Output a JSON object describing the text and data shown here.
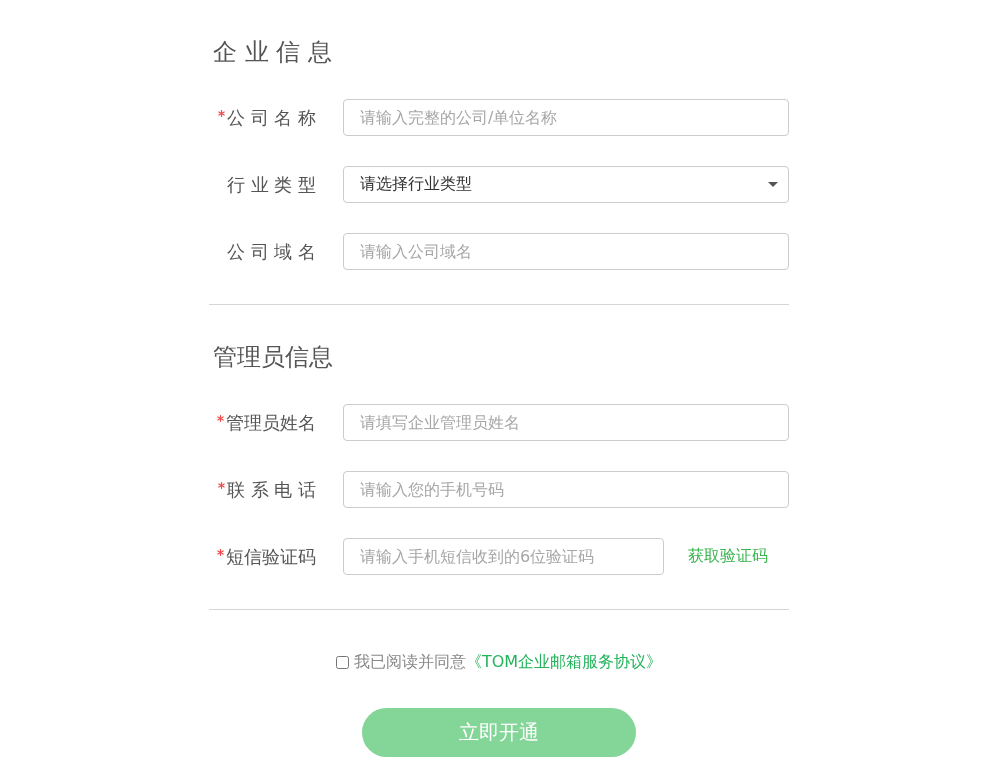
{
  "sections": [
    {
      "title": "企 业 信 息",
      "fields": [
        {
          "kind": "input",
          "label": "公 司 名 称",
          "required": true,
          "placeholder": "请输入完整的公司/单位名称"
        },
        {
          "kind": "select",
          "label": "行 业 类 型",
          "required": false,
          "value": "请选择行业类型"
        },
        {
          "kind": "input",
          "label": "公 司 域 名",
          "required": false,
          "placeholder": "请输入公司域名"
        }
      ]
    },
    {
      "title": "管理员信息",
      "fields": [
        {
          "kind": "input",
          "label": "管理员姓名",
          "required": true,
          "placeholder": "请填写企业管理员姓名"
        },
        {
          "kind": "input",
          "label": "联 系 电 话",
          "required": true,
          "placeholder": "请输入您的手机号码"
        },
        {
          "kind": "input",
          "label": "短信验证码",
          "required": true,
          "placeholder": "请输入手机短信收到的6位验证码",
          "action": "获取验证码"
        }
      ]
    }
  ],
  "agreement": {
    "checked": false,
    "text": "我已阅读并同意",
    "link": "《TOM企业邮箱服务协议》"
  },
  "submit_button": "立即开通"
}
